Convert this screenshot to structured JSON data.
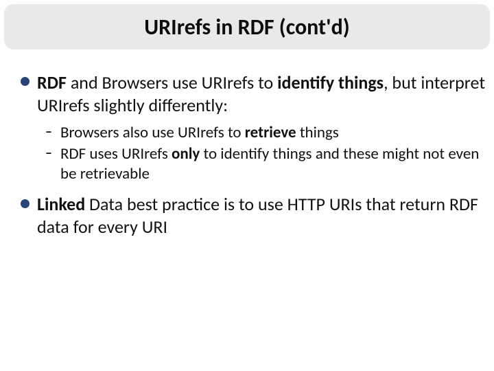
{
  "title": "URIrefs in RDF (cont'd)",
  "bullets": {
    "p1_lead": "RDF",
    "p1_mid": " and Browsers use URIrefs to ",
    "p1_bold": "identify things",
    "p1_tail": ", but interpret URIrefs slightly differently:",
    "s1_a": "Browsers also use URIrefs to ",
    "s1_b": "retrieve",
    "s1_c": " things",
    "s2_a": "RDF uses URIrefs ",
    "s2_b": "only",
    "s2_c": " to identify things and these might not even be retrievable",
    "p2_lead": "Linked",
    "p2_mid": " Data best practice is to use HTTP URIs that return RDF data for every URI"
  },
  "dash": "–"
}
